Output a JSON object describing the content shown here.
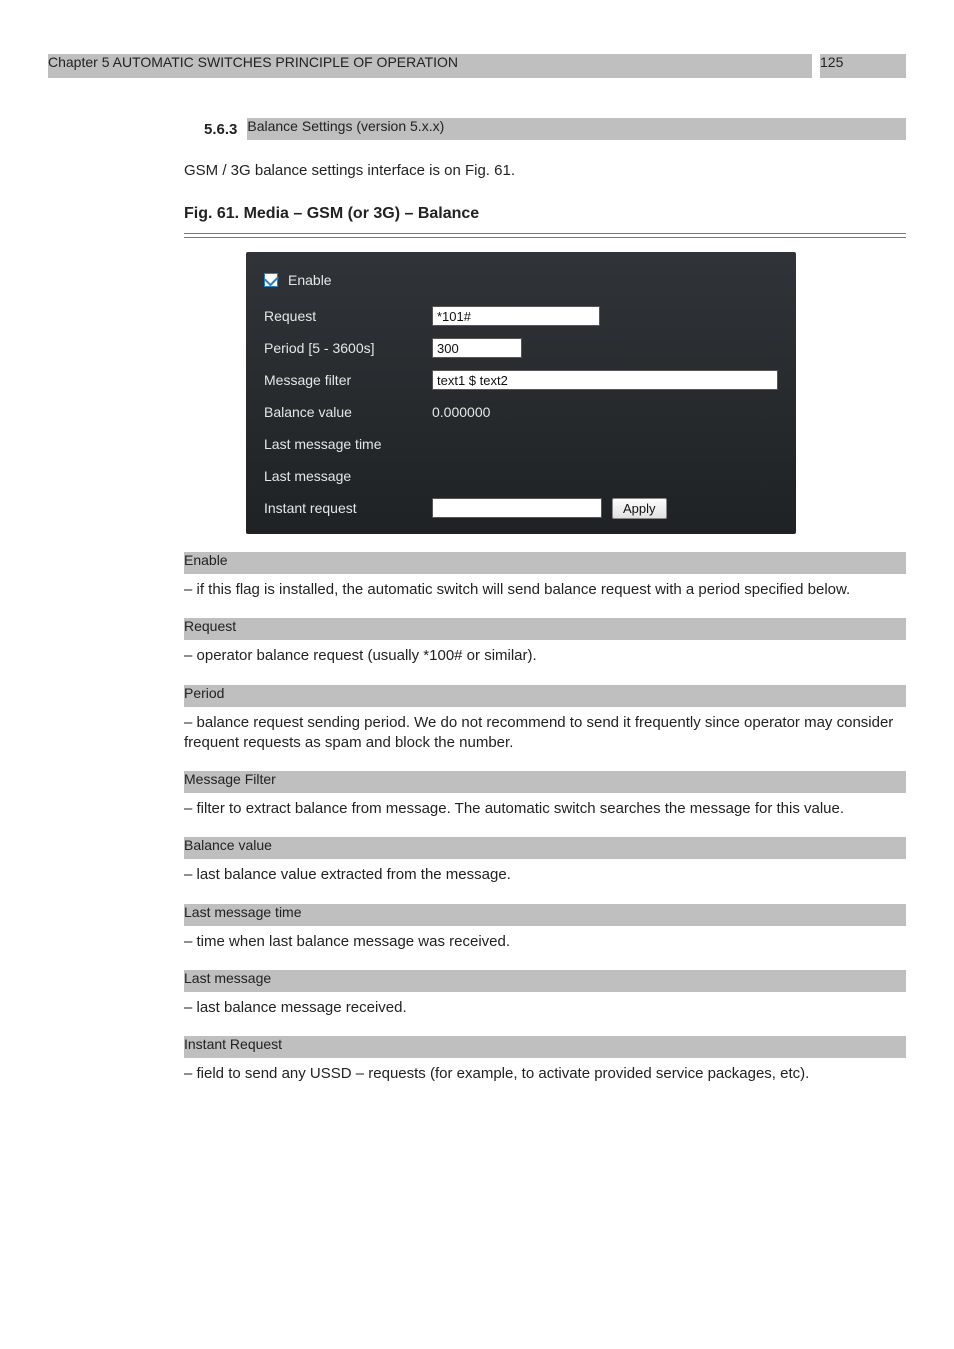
{
  "header": {
    "top_highlight_left": "Chapter 5  AUTOMATIC SWITCHES PRINCIPLE OF OPERATION",
    "top_highlight_right": "125",
    "section_number": "5.6.3",
    "section_title_bar": "Balance Settings (version 5.x.x)"
  },
  "intro": "GSM / 3G balance settings interface is on Fig. 61.",
  "figure_caption": "Fig. 61. Media – GSM (or 3G) – Balance",
  "panel": {
    "enable_checkbox": {
      "label": "Enable",
      "checked": true
    },
    "request": {
      "label": "Request",
      "value": "*101#"
    },
    "period": {
      "label": "Period [5 - 3600s]",
      "value": "300"
    },
    "message_filter": {
      "label": "Message filter",
      "value": "text1 $ text2"
    },
    "balance_value": {
      "label": "Balance value",
      "value": "0.000000"
    },
    "last_message_time": {
      "label": "Last message time",
      "value": ""
    },
    "last_message": {
      "label": "Last message",
      "value": ""
    },
    "instant_request": {
      "label": "Instant request",
      "value": "",
      "button": "Apply"
    }
  },
  "paragraphs": [
    {
      "head": "Enable",
      "text": " – if this flag is installed, the automatic switch will send balance request with a period specified below."
    },
    {
      "head": "Request",
      "text": " – operator balance request (usually *100# or similar)."
    },
    {
      "head": "Period",
      "text": " – balance request sending period. We do not recommend to send it frequently since operator may consider frequent requests as spam and block the number."
    },
    {
      "head": "Message Filter",
      "text": " – filter to extract balance from message. The automatic switch searches the message for this value."
    },
    {
      "head": "Balance value",
      "text": " – last balance value extracted from the message."
    },
    {
      "head": "Last message time",
      "text": " – time when last balance message was received."
    },
    {
      "head": "Last message",
      "text": " – last balance message received."
    },
    {
      "head": "Instant Request",
      "text": " – field to send any USSD – requests (for example, to activate provided service packages, etc)."
    }
  ]
}
